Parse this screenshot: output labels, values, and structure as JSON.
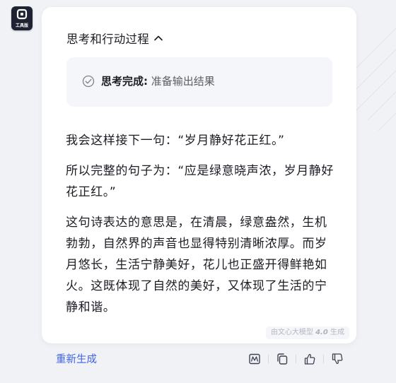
{
  "app": {
    "logo_tag": "工具版",
    "logo_icon": "toolbox-app-logo"
  },
  "thinking": {
    "title": "思考和行动过程",
    "toggle_icon": "chevron-up-icon",
    "status_label": "思考完成:",
    "status_detail": " 准备输出结果",
    "status_icon": "check-circle-icon"
  },
  "response": {
    "paragraphs": [
      "我会这样接下一句：“岁月静好花正红。”",
      "所以完整的句子为：“应是绿意晓声浓，岁月静好花正红。”",
      "这句诗表达的意思是，在清晨，绿意盎然，生机勃勃，自然界的声音也显得特别清晰浓厚。而岁月悠长，生活宁静美好，花儿也正盛开得鲜艳如火。这既体现了自然的美好，又体现了生活的宁静和谐。"
    ],
    "footnote_prefix": "由文心大模型 ",
    "footnote_version": "4.0",
    "footnote_suffix": " 生成"
  },
  "footer": {
    "regenerate_label": "重新生成",
    "actions": [
      "image-icon",
      "copy-icon",
      "thumbs-up-icon",
      "thumbs-down-icon"
    ]
  },
  "colors": {
    "accent": "#3f63e8",
    "background": "#f1f2f6",
    "card": "#ffffff",
    "status_box": "#f5f6f9",
    "text": "#1b1c24"
  }
}
